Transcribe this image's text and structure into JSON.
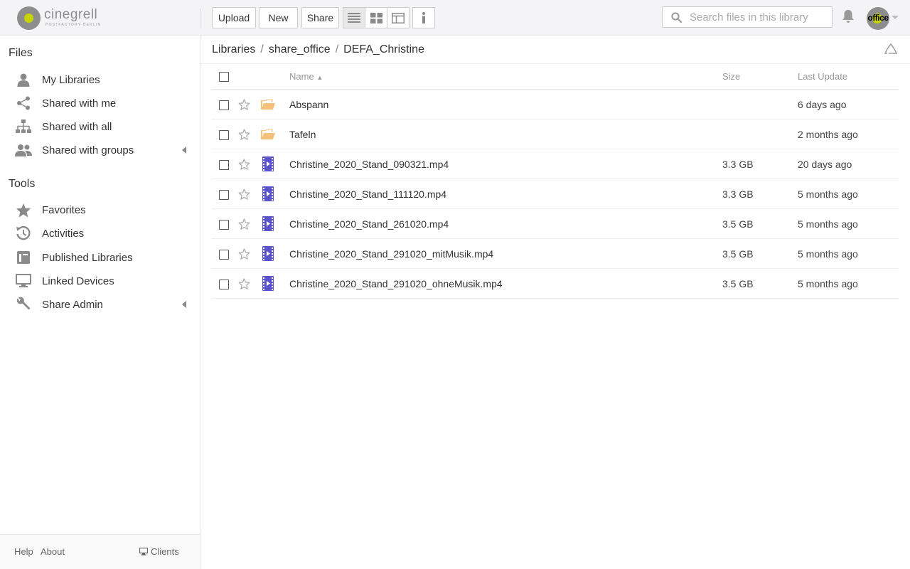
{
  "brand": {
    "name": "cinegrell",
    "tagline": "POSTFACTORY·BERLIN"
  },
  "toolbar": {
    "upload": "Upload",
    "new": "New",
    "share": "Share"
  },
  "view_buttons": [
    "list-view-icon",
    "grid-view-icon",
    "column-view-icon",
    "info-icon"
  ],
  "search": {
    "placeholder": "Search files in this library"
  },
  "user": {
    "avatar_text": "office"
  },
  "sidebar": {
    "files_heading": "Files",
    "files_items": [
      {
        "label": "My Libraries",
        "icon": "user-icon"
      },
      {
        "label": "Shared with me",
        "icon": "share-icon"
      },
      {
        "label": "Shared with all",
        "icon": "org-chart-icon"
      },
      {
        "label": "Shared with groups",
        "icon": "group-icon"
      }
    ],
    "tools_heading": "Tools",
    "tools_items": [
      {
        "label": "Favorites",
        "icon": "star-icon"
      },
      {
        "label": "Activities",
        "icon": "history-icon"
      },
      {
        "label": "Published Libraries",
        "icon": "book-icon"
      },
      {
        "label": "Linked Devices",
        "icon": "monitor-icon"
      },
      {
        "label": "Share Admin",
        "icon": "wrench-icon"
      }
    ],
    "footer": {
      "help": "Help",
      "about": "About",
      "clients": "Clients"
    }
  },
  "breadcrumb": [
    "Libraries",
    "share_office",
    "DEFA_Christine"
  ],
  "table": {
    "headers": {
      "name": "Name",
      "size": "Size",
      "last_update": "Last Update"
    },
    "rows": [
      {
        "type": "folder",
        "name": "Abspann",
        "size": "",
        "last_update": "6 days ago"
      },
      {
        "type": "folder",
        "name": "Tafeln",
        "size": "",
        "last_update": "2 months ago"
      },
      {
        "type": "video",
        "name": "Christine_2020_Stand_090321.mp4",
        "size": "3.3 GB",
        "last_update": "20 days ago"
      },
      {
        "type": "video",
        "name": "Christine_2020_Stand_111120.mp4",
        "size": "3.3 GB",
        "last_update": "5 months ago"
      },
      {
        "type": "video",
        "name": "Christine_2020_Stand_261020.mp4",
        "size": "3.5 GB",
        "last_update": "5 months ago"
      },
      {
        "type": "video",
        "name": "Christine_2020_Stand_291020_mitMusik.mp4",
        "size": "3.5 GB",
        "last_update": "5 months ago"
      },
      {
        "type": "video",
        "name": "Christine_2020_Stand_291020_ohneMusik.mp4",
        "size": "3.5 GB",
        "last_update": "5 months ago"
      }
    ]
  },
  "colors": {
    "accent": "#c8d400",
    "folder": "#f5c17a",
    "video": "#5b53c9",
    "icon_gray": "#8a8a8a"
  }
}
